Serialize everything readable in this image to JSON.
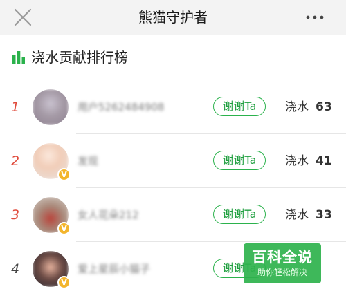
{
  "header": {
    "title": "熊猫守护者",
    "more_label": "···"
  },
  "section": {
    "title": "浇水贡献排行榜"
  },
  "rows": [
    {
      "rank": "1",
      "username": "用户5262484908",
      "thanks_label": "谢谢Ta",
      "water_label": "浇水",
      "water_count": "63",
      "verified": false
    },
    {
      "rank": "2",
      "username": "发现",
      "thanks_label": "谢谢Ta",
      "water_label": "浇水",
      "water_count": "41",
      "verified": true
    },
    {
      "rank": "3",
      "username": "女人花朵212",
      "thanks_label": "谢谢Ta",
      "water_label": "浇水",
      "water_count": "33",
      "verified": true
    },
    {
      "rank": "4",
      "username": "爱上星辰小猫子",
      "thanks_label": "谢谢Ta",
      "water_label": "",
      "water_count": "",
      "verified": true
    }
  ],
  "watermark": {
    "title": "百科全说",
    "subtitle": "助你轻松解决"
  },
  "colors": {
    "accent_green": "#2bb24c",
    "rank_red": "#e04b3c",
    "badge_yellow": "#f3b52d"
  }
}
